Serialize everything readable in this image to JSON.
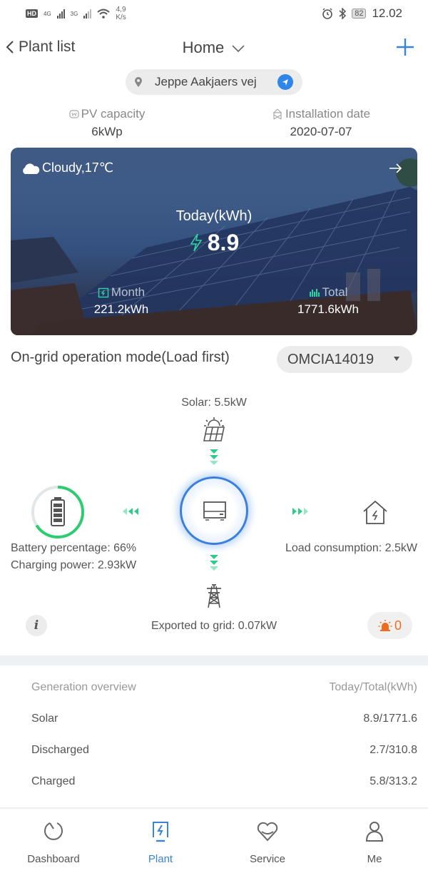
{
  "status_bar": {
    "hd_label": "HD",
    "sim1_network": "4G",
    "sim2_network": "3G",
    "speed_value": "4,9",
    "speed_unit": "K/s",
    "battery_level": "82",
    "time": "12.02"
  },
  "header": {
    "back_label": "Plant list",
    "title": "Home"
  },
  "address": {
    "text": "Jeppe Aakjaers vej"
  },
  "plant_info": {
    "pv_capacity_label": "PV capacity",
    "pv_capacity_value": "6kWp",
    "installation_date_label": "Installation date",
    "installation_date_value": "2020-07-07"
  },
  "hero": {
    "weather": "Cloudy,17℃",
    "today_label": "Today(kWh)",
    "today_value": "8.9",
    "month_label": "Month",
    "month_value": "221.2kWh",
    "total_label": "Total",
    "total_value": "1771.6kWh"
  },
  "operation": {
    "mode_label": "On-grid operation mode(Load first)",
    "device_selected": "OMCIA14019"
  },
  "flow": {
    "solar_text": "Solar: 5.5kW",
    "battery_percentage_text": "Battery percentage: 66%",
    "battery_percentage": 66,
    "charging_power_text": "Charging power: 2.93kW",
    "load_text": "Load consumption: 2.5kW",
    "grid_text": "Exported to grid: 0.07kW",
    "alarm_count": "0",
    "colors": {
      "flow_arrow": "#2ecc8a",
      "battery_ring": "#2ecc71",
      "inverter_ring": "#3a7fde",
      "alarm": "#ef6b22"
    }
  },
  "overview": {
    "title": "Generation overview",
    "unit_label": "Today/Total(kWh)",
    "rows": [
      {
        "label": "Solar",
        "value": "8.9/1771.6"
      },
      {
        "label": "Discharged",
        "value": "2.7/310.8"
      },
      {
        "label": "Charged",
        "value": "5.8/313.2"
      }
    ]
  },
  "bottom_nav": {
    "active": "Plant",
    "accent": "#3a83d6",
    "items": [
      {
        "label": "Dashboard",
        "icon": "dashboard-icon"
      },
      {
        "label": "Plant",
        "icon": "plant-icon"
      },
      {
        "label": "Service",
        "icon": "service-icon"
      },
      {
        "label": "Me",
        "icon": "me-icon"
      }
    ]
  }
}
